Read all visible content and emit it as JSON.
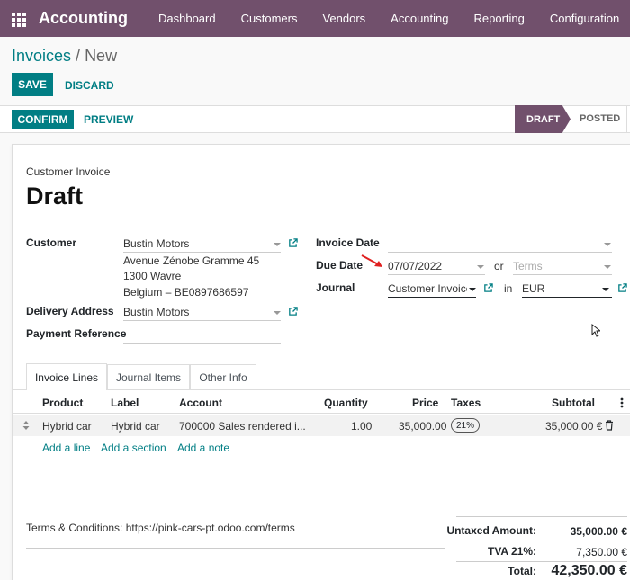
{
  "navbar": {
    "app_name": "Accounting",
    "menu": [
      "Dashboard",
      "Customers",
      "Vendors",
      "Accounting",
      "Reporting",
      "Configuration"
    ]
  },
  "breadcrumb": {
    "parent": "Invoices",
    "separator": " / ",
    "current": "New"
  },
  "actions": {
    "save": "SAVE",
    "discard": "DISCARD",
    "confirm": "CONFIRM",
    "preview": "PREVIEW"
  },
  "status": {
    "draft": "DRAFT",
    "posted": "POSTED"
  },
  "invoice": {
    "subtitle": "Customer Invoice",
    "title": "Draft",
    "customer_label": "Customer",
    "customer": "Bustin Motors",
    "address_line1": "Avenue Zénobe Gramme 45",
    "address_line2": "1300 Wavre",
    "address_line3": "Belgium – BE0897686597",
    "delivery_label": "Delivery Address",
    "delivery": "Bustin Motors",
    "payment_ref_label": "Payment Reference",
    "payment_ref": "",
    "invoice_date_label": "Invoice Date",
    "invoice_date": "",
    "due_date_label": "Due Date",
    "due_date": "07/07/2022",
    "or_label": "or",
    "terms_placeholder": "Terms",
    "journal_label": "Journal",
    "journal": "Customer Invoice",
    "in_label": "in",
    "currency": "EUR"
  },
  "tabs": [
    "Invoice Lines",
    "Journal Items",
    "Other Info"
  ],
  "table": {
    "headers": {
      "product": "Product",
      "label": "Label",
      "account": "Account",
      "quantity": "Quantity",
      "price": "Price",
      "taxes": "Taxes",
      "subtotal": "Subtotal"
    },
    "rows": [
      {
        "product": "Hybrid car",
        "label": "Hybrid car",
        "account": "700000 Sales rendered i...",
        "quantity": "1.00",
        "price": "35,000.00",
        "tax": "21%",
        "subtotal": "35,000.00 €"
      }
    ],
    "add_line": "Add a line",
    "add_section": "Add a section",
    "add_note": "Add a note"
  },
  "terms": "Terms & Conditions: https://pink-cars-pt.odoo.com/terms",
  "totals": {
    "untaxed_label": "Untaxed Amount:",
    "untaxed": "35,000.00 €",
    "tva_label": "TVA 21%:",
    "tva": "7,350.00 €",
    "total_label": "Total:",
    "total": "42,350.00 €"
  },
  "colors": {
    "brand": "#71506c",
    "primary": "#017e84"
  }
}
